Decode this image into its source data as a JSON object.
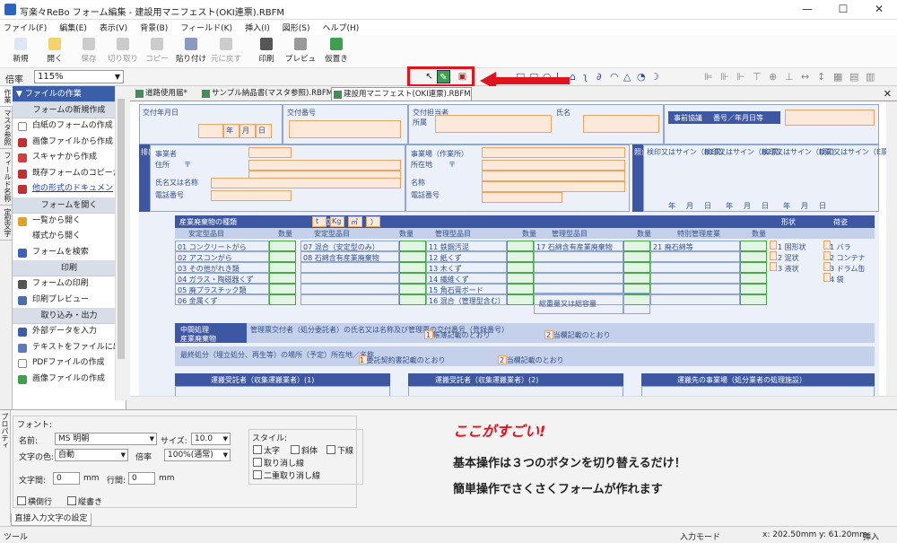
{
  "window": {
    "title": "写楽々ReBo フォーム編集 - 建設用マニフェスト(OKI連票).RBFM",
    "minimize": "—",
    "maximize": "☐",
    "close": "✕"
  },
  "menu": [
    "ファイル(F)",
    "編集(E)",
    "表示(V)",
    "背景(B)",
    "フィールド(K)",
    "挿入(I)",
    "図形(S)",
    "ヘルプ(H)"
  ],
  "toolbar": [
    {
      "label": "新規",
      "dis": false,
      "c": "#dfe7f5"
    },
    {
      "label": "開く",
      "dis": false,
      "c": "#f5d36b"
    },
    {
      "label": "保存",
      "dis": true,
      "c": "#ccc"
    },
    {
      "label": "切り取り",
      "dis": true,
      "c": "#ccc"
    },
    {
      "label": "コピー",
      "dis": true,
      "c": "#ccc"
    },
    {
      "label": "貼り付け",
      "dis": false,
      "c": "#8a9bc3"
    },
    {
      "label": "元に戻す",
      "dis": true,
      "c": "#ccc"
    },
    {
      "label": "印刷",
      "dis": false,
      "c": "#555"
    },
    {
      "label": "プレビュー",
      "dis": false,
      "c": "#999"
    },
    {
      "label": "仮置き",
      "dis": false,
      "c": "#3e9f4f"
    }
  ],
  "zoom": {
    "label": "倍率",
    "value": "115%"
  },
  "tools": {
    "arrow": "↖",
    "pen": "✎",
    "note": "▣"
  },
  "sidetabs": [
    "作業",
    "マスタ参照",
    "フィールド名称",
    "定型文字"
  ],
  "panel": [
    {
      "t": "sec top",
      "label": "ファイルの作業"
    },
    {
      "t": "sec",
      "label": "フォームの新規作成"
    },
    {
      "t": "it",
      "label": "白紙のフォームの作成",
      "c": "#fff",
      "b": true
    },
    {
      "t": "it",
      "label": "画像ファイルから作成",
      "c": "#c03030"
    },
    {
      "t": "it",
      "label": "スキャナから作成",
      "c": "#d04040"
    },
    {
      "t": "it",
      "label": "既存フォームのコピーか",
      "c": "#c03030"
    },
    {
      "t": "it link",
      "label": "他の形式のドキュメン",
      "c": "#c03030"
    },
    {
      "t": "sec",
      "label": "フォームを開く"
    },
    {
      "t": "it",
      "label": "一覧から開く",
      "c": "#e0a030"
    },
    {
      "t": "it",
      "label": "様式から開く",
      "c": "#fff"
    },
    {
      "t": "it",
      "label": "フォームを検索",
      "c": "#4060c0"
    },
    {
      "t": "sec",
      "label": "印刷"
    },
    {
      "t": "it",
      "label": "フォームの印刷",
      "c": "#555"
    },
    {
      "t": "it",
      "label": "印刷プレビュー",
      "c": "#4a6fa8"
    },
    {
      "t": "sec",
      "label": "取り込み・出力"
    },
    {
      "t": "it",
      "label": "外部データを入力",
      "c": "#3a5ea8"
    },
    {
      "t": "it",
      "label": "テキストをファイルに出",
      "c": "#5a7ab8"
    },
    {
      "t": "it",
      "label": "PDFファイルの作成",
      "c": "#fff",
      "b": true
    },
    {
      "t": "it",
      "label": "画像ファイルの作成",
      "c": "#3e9f4f"
    }
  ],
  "tabs": [
    "道路使用届*",
    "サンプル納品書(マスタ参照).RBFM",
    "建設用マニフェスト(OKI連票).RBFM"
  ],
  "form": {
    "k": [
      "交付年月日",
      "年",
      "月",
      "日",
      "交付番号",
      "交付担当者",
      "所属",
      "氏名",
      "事前協議",
      "番号／年月日等",
      "排出事業者",
      "事業者",
      "住所",
      "〒",
      "氏名又は名称",
      "電話番号",
      "事業場（作業所）",
      "所在地",
      "〒",
      "名称",
      "電話番号",
      "照合確認日",
      "検印又はサイン（B1票）",
      "検印又はサイン（B2票）",
      "検印又はサイン（D票）",
      "検印又はサイン（E票）",
      "年",
      "月",
      "日",
      "産業廃棄物の種類",
      "（単位：",
      "t",
      "Kg",
      "㎥",
      "）",
      "安定型品目",
      "数量",
      "安定型品目",
      "数量",
      "管理型品目",
      "数量",
      "管理型品目",
      "数量",
      "特別管理産業",
      "数量",
      "形状",
      "荷姿",
      "01 コンクリートがら",
      "07 混合（安定型のみ）",
      "11 鉄鋼汚泥",
      "17 石綿含有産業廃棄物",
      "21 廃石綿等",
      "1 固形状",
      "1 バラ",
      "02 アスコンがら",
      "08 石綿含有産業廃棄物",
      "12 紙くず",
      "2 泥状",
      "2 コンテナ",
      "03 その他がれき類",
      "13 木くず",
      "3 液状",
      "3 ドラム缶",
      "04 ガラス・陶磁器くず",
      "14 繊維くず",
      "4 袋",
      "05 廃プラスチック類",
      "15 角石膏ボード",
      "06 金属くず",
      "16 混合（管理型含む）",
      "総重量又は総容量",
      "中間処理",
      "産業廃棄物",
      "管理票交付者（処分委託者）の氏名又は名称及び管理票の交付番号（登録番号）",
      "1 帳簿記載のとおり",
      "2 当欄記載のとおり",
      "最終処分（埋立処分、再生等）の場所（予定）所在地／名称",
      "1 委託契約書記載のとおり",
      "2 当欄記載のとおり",
      "運搬受託者（収集運搬業者）(1)",
      "運搬受託者（収集運搬業者）(2)",
      "運搬先の事業場（処分業者の処理施設）"
    ]
  },
  "props": {
    "side": "プロパティ",
    "group": "フォント:",
    "name_label": "名前:",
    "font": "MS 明朝",
    "size_label": "サイズ:",
    "size": "10.0",
    "color_label": "文字の色:",
    "color": "自動",
    "ratio_label": "倍率",
    "ratio": "100%(通常)",
    "cs_label": "文字間:",
    "cs": "0",
    "unit1": "mm",
    "ls_label": "行間:",
    "ls": "0",
    "unit2": "mm",
    "style_title": "スタイル:",
    "bold": "太字",
    "italic": "斜体",
    "underline": "下線",
    "strike": "取り消し線",
    "dstrike": "二重取り消し線",
    "wrap": "横倒行",
    "vert": "縦書き",
    "tab": "直接入力文字の設定"
  },
  "promo": {
    "title": "ここがすごい!",
    "line1": "基本操作は３つのボタンを切り替えるだけ！",
    "line2": "簡単操作でさくさくフォームが作れます"
  },
  "status": {
    "left": "ツール",
    "mode": "入力モード",
    "coords": "x: 202.50mm  y: 61.20mm",
    "ins": "挿入"
  },
  "colors": {
    "accent": "#e0141e",
    "navy": "#3d57a3",
    "promo": "#e0141e"
  }
}
